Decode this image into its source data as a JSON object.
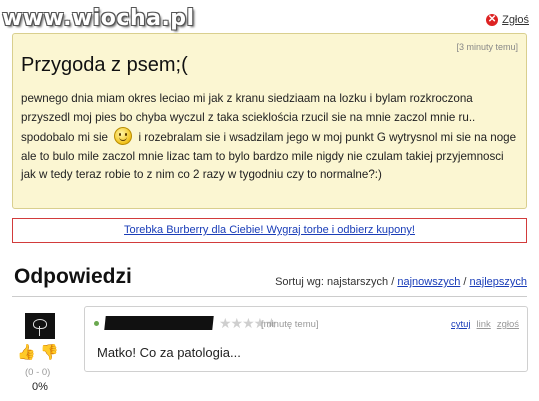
{
  "watermark": "www.wiocha.pl",
  "report": {
    "label": "Zgłoś",
    "icon": "close-icon"
  },
  "post": {
    "time": "[3 minuty temu]",
    "title": "Przygoda z psem;(",
    "body_part1": "pewnego dnia miam okres leciao mi jak z kranu siedziaam na lozku i bylam rozkroczona przyszedl moj pies bo chyba wyczul z taka scieklościa rzucil sie na mnie zaczol mnie ru.. spodobalo mi sie",
    "body_part2": "i rozebralam sie i wsadzilam jego w moj punkt G wytrysnol mi sie na noge ale to bulo mile zaczol mnie lizac tam to bylo bardzo mile nigdy nie czulam takiej przyjemnosci jak w tedy teraz robie to z nim co 2 razy w tygodniu czy to normalne?:)"
  },
  "ad": {
    "text": "Torebka Burberry dla Ciebie! Wygraj torbe i odbierz kupony!"
  },
  "answers": {
    "title": "Odpowiedzi",
    "sort_label": "Sortuj wg: najstarszych /",
    "sort_newest": "najnowszych",
    "sort_sep": "/",
    "sort_best": "najlepszych"
  },
  "comment": {
    "stars": "★★★★★",
    "time": "[minutę temu]",
    "actions": {
      "quote": "cytuj",
      "link": "link",
      "report": "zgłoś"
    },
    "text": "Matko! Co za patologia...",
    "score": "(0 - 0)",
    "percent": "0%"
  }
}
